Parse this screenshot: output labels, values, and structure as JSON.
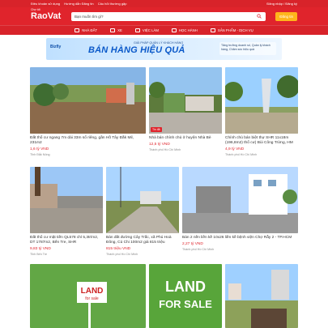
{
  "topbar": {
    "links": [
      "Điều khoản sử dụng",
      "Hướng dẫn Đăng tin",
      "Câu hỏi thường gặp"
    ],
    "account": "Đăng nhập / Đăng ký"
  },
  "header": {
    "logo_small": "Chợ tốt",
    "logo_main": "RaoVat",
    "search_placeholder": "Bạn muốn tìm gì?",
    "post_label": "Đăng tin"
  },
  "nav": {
    "items": [
      "NHÀ ĐẤT",
      "XE",
      "VIỆC LÀM",
      "HỌC HÀNH",
      "SẢN PHẨM - DỊCH VỤ"
    ]
  },
  "banner": {
    "brand": "Bizfly",
    "subtitle": "GIẢI PHÁP QUẢN LÝ KHÁCH HÀNG",
    "headline": "BÁN HÀNG HIỆU QUẢ",
    "badge": "Tăng trưởng doanh số, Quản lý khách hàng, Chăm sóc hiệu quả"
  },
  "listings": [
    {
      "title": "Đất thổ cư ngang 7m dài 33m sổ riêng, gần Hồ Tây Đắk Mil, 231m2",
      "price": "1,6 tỷ VND",
      "location": "Tỉnh Đắk Nông",
      "tag": ""
    },
    {
      "title": "Nhà bán chính chủ ở huyện Nhà Bè",
      "price": "12,5 tỷ VND",
      "location": "Thành phố Hồ Chí Minh",
      "tag": "Tin đã"
    },
    {
      "title": "Chính chủ bán biệt thự SHR 11x18m (196,8m2) thổ cư) Bùi Công Trừng, HM",
      "price": "4,9 tỷ VND",
      "location": "Thành phố Hồ Chí Minh",
      "tag": ""
    },
    {
      "title": "Đất thổ cư mặt tiền QL578 chỉ 5,3tr/m2, DT 1787m2, Bến Tre, SHR",
      "price": "9,83 tỷ VND",
      "location": "Tỉnh Bến Tre",
      "tag": ""
    },
    {
      "title": "Bán đất đường Cây Trắc, xã Phú Hoà Đông, Củ Chi 100m2 giá 815 triệu",
      "price": "815 triệu VND",
      "location": "Thành phố Hồ Chí Minh",
      "tag": ""
    },
    {
      "title": "Bán 2 nền liền kề 10x26 liền kề bệnh viện Chợ Rẫy 2 - TP.HCM",
      "price": "2,27 tỷ VND",
      "location": "Thành phố Hồ Chí Minh",
      "tag": ""
    }
  ],
  "bottom_images": [
    {
      "text_top": "LAND",
      "text_bottom": "for sale"
    },
    {
      "text_top": "LAND",
      "text_bottom": "FOR SALE"
    }
  ],
  "colors": {
    "brand_red": "#e0242c",
    "accent_yellow": "#ffb51b"
  }
}
